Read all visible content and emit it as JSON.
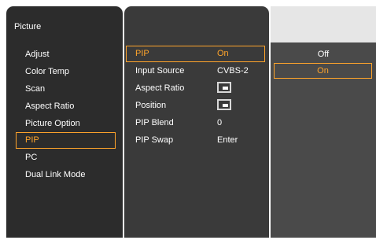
{
  "menu": {
    "title": "Picture",
    "items": [
      {
        "label": "Adjust"
      },
      {
        "label": "Color Temp"
      },
      {
        "label": "Scan"
      },
      {
        "label": "Aspect Ratio"
      },
      {
        "label": "Picture Option"
      },
      {
        "label": "PIP"
      },
      {
        "label": "PC"
      },
      {
        "label": "Dual Link Mode"
      }
    ],
    "selected": "PIP"
  },
  "submenu": {
    "items": [
      {
        "label": "PIP",
        "value": "On"
      },
      {
        "label": "Input Source",
        "value": "CVBS-2"
      },
      {
        "label": "Aspect Ratio",
        "value_icon": "aspect-ratio-icon"
      },
      {
        "label": "Position",
        "value_icon": "position-icon"
      },
      {
        "label": "PIP Blend",
        "value": "0"
      },
      {
        "label": "PIP Swap",
        "value": "Enter"
      }
    ],
    "selected": "PIP"
  },
  "options": {
    "items": [
      {
        "label": "Off"
      },
      {
        "label": "On"
      }
    ],
    "selected": "On"
  },
  "colors": {
    "accent": "#ffa42b",
    "panel_dark": "#2c2c2c",
    "panel_mid": "#3a3a3a",
    "panel_light": "#4a4a4a",
    "text": "#ffffff"
  }
}
